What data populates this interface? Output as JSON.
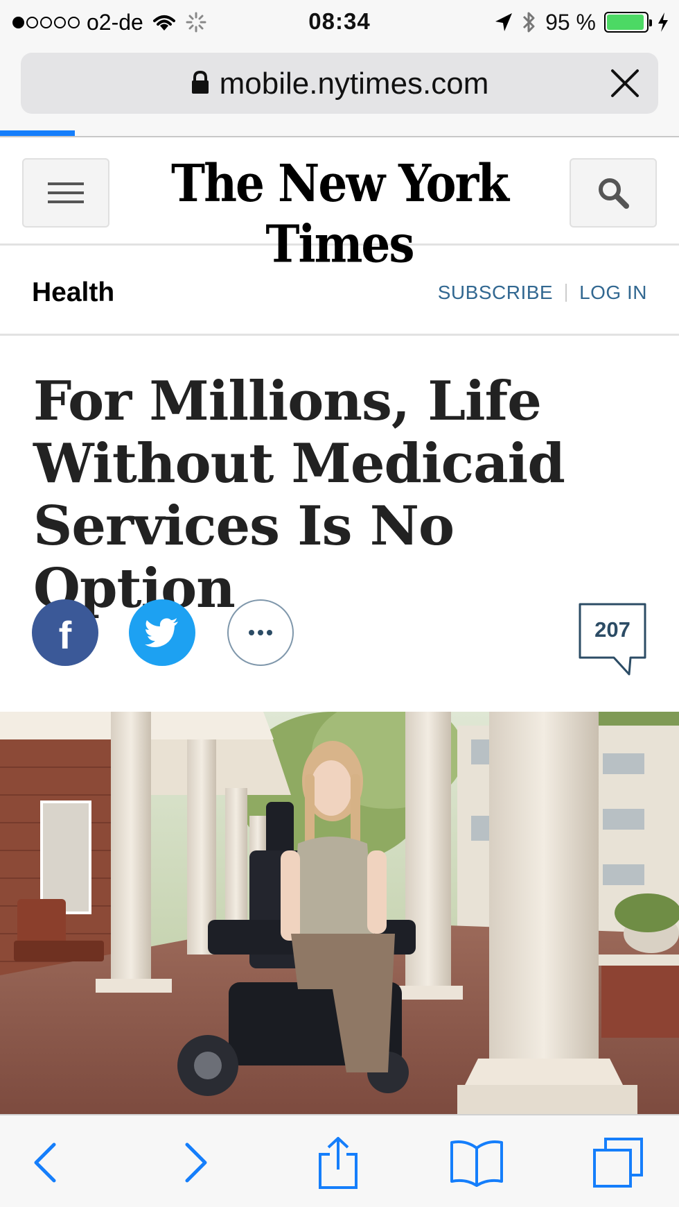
{
  "status_bar": {
    "carrier": "o2-de",
    "time": "08:34",
    "battery_percent": "95 %",
    "battery_level": 0.95,
    "signal_bars_filled": 1,
    "signal_bars_total": 5
  },
  "browser": {
    "url": "mobile.nytimes.com",
    "load_progress": 0.11
  },
  "masthead": {
    "logo_text": "The New York Times"
  },
  "section": {
    "name": "Health",
    "subscribe_label": "SUBSCRIBE",
    "login_label": "LOG IN"
  },
  "article": {
    "headline_lines": [
      "For Millions, Life",
      "Without Medicaid",
      "Services Is No Option"
    ],
    "comment_count": "207"
  },
  "share": {
    "facebook_glyph": "f",
    "icons": [
      "facebook-icon",
      "twitter-icon",
      "more-icon",
      "comment-icon"
    ]
  },
  "colors": {
    "accent": "#157efb",
    "link": "#326891",
    "facebook": "#3b5998",
    "twitter": "#1da1f2",
    "battery": "#4cd964"
  },
  "toolbar": {
    "icons": [
      "back-icon",
      "forward-icon",
      "share-icon",
      "bookmarks-icon",
      "tabs-icon"
    ]
  }
}
